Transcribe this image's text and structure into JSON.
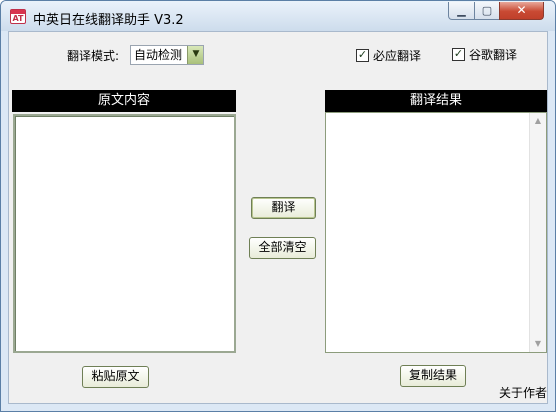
{
  "window": {
    "title": "中英日在线翻译助手 V3.2",
    "app_icon_glyph": "AT",
    "controls": {
      "minimize": "▁",
      "maximize": "▢",
      "close": "✕"
    }
  },
  "toolbar": {
    "mode_label": "翻译模式:",
    "mode_value": "自动检测",
    "mode_dropdown_glyph": "▼",
    "engines": [
      {
        "label": "必应翻译",
        "checked": true
      },
      {
        "label": "谷歌翻译",
        "checked": true
      }
    ],
    "check_glyph": "✓"
  },
  "source_panel": {
    "header": "原文内容",
    "text": ""
  },
  "result_panel": {
    "header": "翻译结果",
    "text": "",
    "scroll_up": "▲",
    "scroll_down": "▼"
  },
  "buttons": {
    "translate": "翻译",
    "clear_all": "全部清空",
    "paste_source": "粘贴原文",
    "copy_result": "复制结果"
  },
  "footer": {
    "about": "关于作者"
  },
  "colors": {
    "panel_header_bg": "#000000",
    "client_bg": "#f0f0f0",
    "close_button": "#c94a33"
  }
}
